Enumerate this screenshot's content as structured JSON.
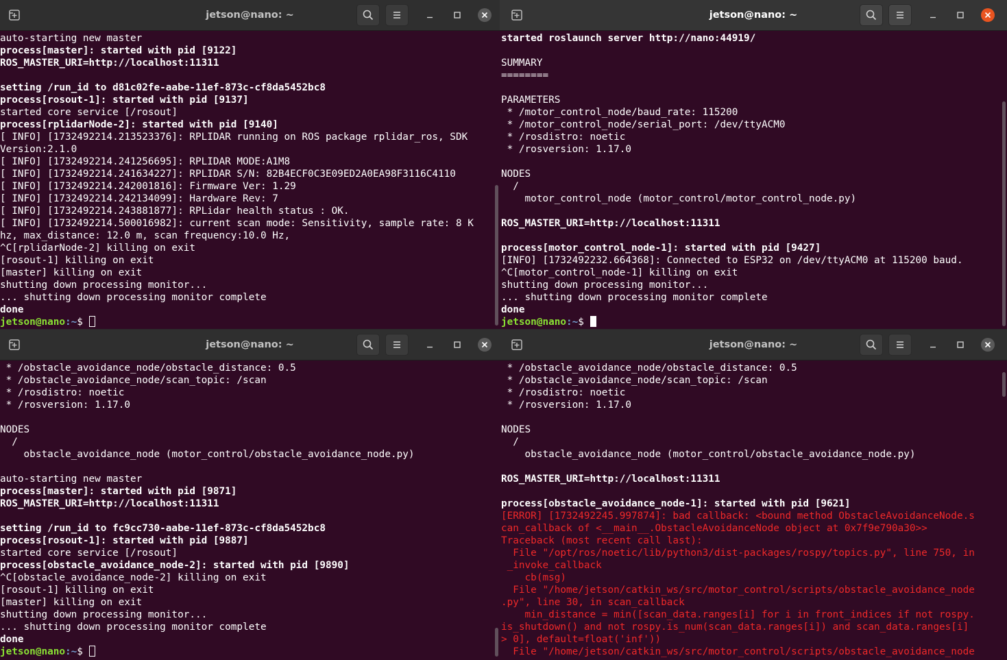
{
  "colors": {
    "terminal_bg": "#300a24",
    "prompt_user": "#8ae234",
    "prompt_path": "#729fcf",
    "error": "#ef2929",
    "close_active": "#e95420"
  },
  "icons": [
    "new-tab-icon",
    "search-icon",
    "hamburger-menu-icon",
    "minimize-icon",
    "maximize-icon",
    "close-icon"
  ],
  "windows": {
    "top_left": {
      "title": "jetson@nano: ~",
      "lines": [
        {
          "t": "auto-starting new master",
          "s": "n"
        },
        {
          "t": "process[master]: started with pid [9122]",
          "s": "b"
        },
        {
          "t": "ROS_MASTER_URI=http://localhost:11311",
          "s": "b"
        },
        {
          "t": "",
          "s": "n"
        },
        {
          "t": "setting /run_id to d81c02fe-aabe-11ef-873c-cf8da5452bc8",
          "s": "b"
        },
        {
          "t": "process[rosout-1]: started with pid [9137]",
          "s": "b"
        },
        {
          "t": "started core service [/rosout]",
          "s": "n"
        },
        {
          "t": "process[rplidarNode-2]: started with pid [9140]",
          "s": "b"
        },
        {
          "t": "[ INFO] [1732492214.213523376]: RPLIDAR running on ROS package rplidar_ros, SDK",
          "s": "n"
        },
        {
          "t": "Version:2.1.0",
          "s": "n"
        },
        {
          "t": "[ INFO] [1732492214.241256695]: RPLIDAR MODE:A1M8",
          "s": "n"
        },
        {
          "t": "[ INFO] [1732492214.241634227]: RPLIDAR S/N: 82B4ECF0C3E09ED2A0EA98F3116C4110",
          "s": "n"
        },
        {
          "t": "[ INFO] [1732492214.242001816]: Firmware Ver: 1.29",
          "s": "n"
        },
        {
          "t": "[ INFO] [1732492214.242134099]: Hardware Rev: 7",
          "s": "n"
        },
        {
          "t": "[ INFO] [1732492214.243881877]: RPLidar health status : OK.",
          "s": "n"
        },
        {
          "t": "[ INFO] [1732492214.500016982]: current scan mode: Sensitivity, sample rate: 8 K",
          "s": "n"
        },
        {
          "t": "hz, max_distance: 12.0 m, scan frequency:10.0 Hz,",
          "s": "n"
        },
        {
          "t": "^C[rplidarNode-2] killing on exit",
          "s": "n"
        },
        {
          "t": "[rosout-1] killing on exit",
          "s": "n"
        },
        {
          "t": "[master] killing on exit",
          "s": "n"
        },
        {
          "t": "shutting down processing monitor...",
          "s": "n"
        },
        {
          "t": "... shutting down processing monitor complete",
          "s": "n"
        },
        {
          "t": "done",
          "s": "b"
        }
      ],
      "prompt": {
        "user": "jetson@nano",
        "path": ":~",
        "symbol": "$ "
      }
    },
    "top_right": {
      "title": "jetson@nano: ~",
      "lines": [
        {
          "t": "started roslaunch server http://nano:44919/",
          "s": "b"
        },
        {
          "t": "",
          "s": "n"
        },
        {
          "t": "SUMMARY",
          "s": "n"
        },
        {
          "t": "========",
          "s": "n"
        },
        {
          "t": "",
          "s": "n"
        },
        {
          "t": "PARAMETERS",
          "s": "n"
        },
        {
          "t": " * /motor_control_node/baud_rate: 115200",
          "s": "n"
        },
        {
          "t": " * /motor_control_node/serial_port: /dev/ttyACM0",
          "s": "n"
        },
        {
          "t": " * /rosdistro: noetic",
          "s": "n"
        },
        {
          "t": " * /rosversion: 1.17.0",
          "s": "n"
        },
        {
          "t": "",
          "s": "n"
        },
        {
          "t": "NODES",
          "s": "n"
        },
        {
          "t": "  /",
          "s": "n"
        },
        {
          "t": "    motor_control_node (motor_control/motor_control_node.py)",
          "s": "n"
        },
        {
          "t": "",
          "s": "n"
        },
        {
          "t": "ROS_MASTER_URI=http://localhost:11311",
          "s": "b"
        },
        {
          "t": "",
          "s": "n"
        },
        {
          "t": "process[motor_control_node-1]: started with pid [9427]",
          "s": "b"
        },
        {
          "t": "[INFO] [1732492232.664368]: Connected to ESP32 on /dev/ttyACM0 at 115200 baud.",
          "s": "n"
        },
        {
          "t": "^C[motor_control_node-1] killing on exit",
          "s": "n"
        },
        {
          "t": "shutting down processing monitor...",
          "s": "n"
        },
        {
          "t": "... shutting down processing monitor complete",
          "s": "n"
        },
        {
          "t": "done",
          "s": "b"
        }
      ],
      "prompt": {
        "user": "jetson@nano",
        "path": ":~",
        "symbol": "$ "
      }
    },
    "bottom_left": {
      "title": "jetson@nano: ~",
      "lines": [
        {
          "t": " * /obstacle_avoidance_node/obstacle_distance: 0.5",
          "s": "n"
        },
        {
          "t": " * /obstacle_avoidance_node/scan_topic: /scan",
          "s": "n"
        },
        {
          "t": " * /rosdistro: noetic",
          "s": "n"
        },
        {
          "t": " * /rosversion: 1.17.0",
          "s": "n"
        },
        {
          "t": "",
          "s": "n"
        },
        {
          "t": "NODES",
          "s": "n"
        },
        {
          "t": "  /",
          "s": "n"
        },
        {
          "t": "    obstacle_avoidance_node (motor_control/obstacle_avoidance_node.py)",
          "s": "n"
        },
        {
          "t": "",
          "s": "n"
        },
        {
          "t": "auto-starting new master",
          "s": "n"
        },
        {
          "t": "process[master]: started with pid [9871]",
          "s": "b"
        },
        {
          "t": "ROS_MASTER_URI=http://localhost:11311",
          "s": "b"
        },
        {
          "t": "",
          "s": "n"
        },
        {
          "t": "setting /run_id to fc9cc730-aabe-11ef-873c-cf8da5452bc8",
          "s": "b"
        },
        {
          "t": "process[rosout-1]: started with pid [9887]",
          "s": "b"
        },
        {
          "t": "started core service [/rosout]",
          "s": "n"
        },
        {
          "t": "process[obstacle_avoidance_node-2]: started with pid [9890]",
          "s": "b"
        },
        {
          "t": "^C[obstacle_avoidance_node-2] killing on exit",
          "s": "n"
        },
        {
          "t": "[rosout-1] killing on exit",
          "s": "n"
        },
        {
          "t": "[master] killing on exit",
          "s": "n"
        },
        {
          "t": "shutting down processing monitor...",
          "s": "n"
        },
        {
          "t": "... shutting down processing monitor complete",
          "s": "n"
        },
        {
          "t": "done",
          "s": "b"
        }
      ],
      "prompt": {
        "user": "jetson@nano",
        "path": ":~",
        "symbol": "$ "
      }
    },
    "bottom_right": {
      "title": "jetson@nano: ~",
      "lines": [
        {
          "t": " * /obstacle_avoidance_node/obstacle_distance: 0.5",
          "s": "n"
        },
        {
          "t": " * /obstacle_avoidance_node/scan_topic: /scan",
          "s": "n"
        },
        {
          "t": " * /rosdistro: noetic",
          "s": "n"
        },
        {
          "t": " * /rosversion: 1.17.0",
          "s": "n"
        },
        {
          "t": "",
          "s": "n"
        },
        {
          "t": "NODES",
          "s": "n"
        },
        {
          "t": "  /",
          "s": "n"
        },
        {
          "t": "    obstacle_avoidance_node (motor_control/obstacle_avoidance_node.py)",
          "s": "n"
        },
        {
          "t": "",
          "s": "n"
        },
        {
          "t": "ROS_MASTER_URI=http://localhost:11311",
          "s": "b"
        },
        {
          "t": "",
          "s": "n"
        },
        {
          "t": "process[obstacle_avoidance_node-1]: started with pid [9621]",
          "s": "b"
        },
        {
          "t": "[ERROR] [1732492245.997874]: bad callback: <bound method ObstacleAvoidanceNode.s",
          "s": "e"
        },
        {
          "t": "can_callback of <__main__.ObstacleAvoidanceNode object at 0x7f9e790a30>>",
          "s": "e"
        },
        {
          "t": "Traceback (most recent call last):",
          "s": "e"
        },
        {
          "t": "  File \"/opt/ros/noetic/lib/python3/dist-packages/rospy/topics.py\", line 750, in",
          "s": "e"
        },
        {
          "t": " _invoke_callback",
          "s": "e"
        },
        {
          "t": "    cb(msg)",
          "s": "e"
        },
        {
          "t": "  File \"/home/jetson/catkin_ws/src/motor_control/scripts/obstacle_avoidance_node",
          "s": "e"
        },
        {
          "t": ".py\", line 30, in scan_callback",
          "s": "e"
        },
        {
          "t": "    min_distance = min([scan_data.ranges[i] for i in front_indices if not rospy.",
          "s": "e"
        },
        {
          "t": "is_shutdown() and not rospy.is_num(scan_data.ranges[i]) and scan_data.ranges[i]",
          "s": "e"
        },
        {
          "t": "> 0], default=float('inf'))",
          "s": "e"
        },
        {
          "t": "  File \"/home/jetson/catkin_ws/src/motor_control/scripts/obstacle_avoidance_node",
          "s": "e"
        }
      ]
    }
  }
}
